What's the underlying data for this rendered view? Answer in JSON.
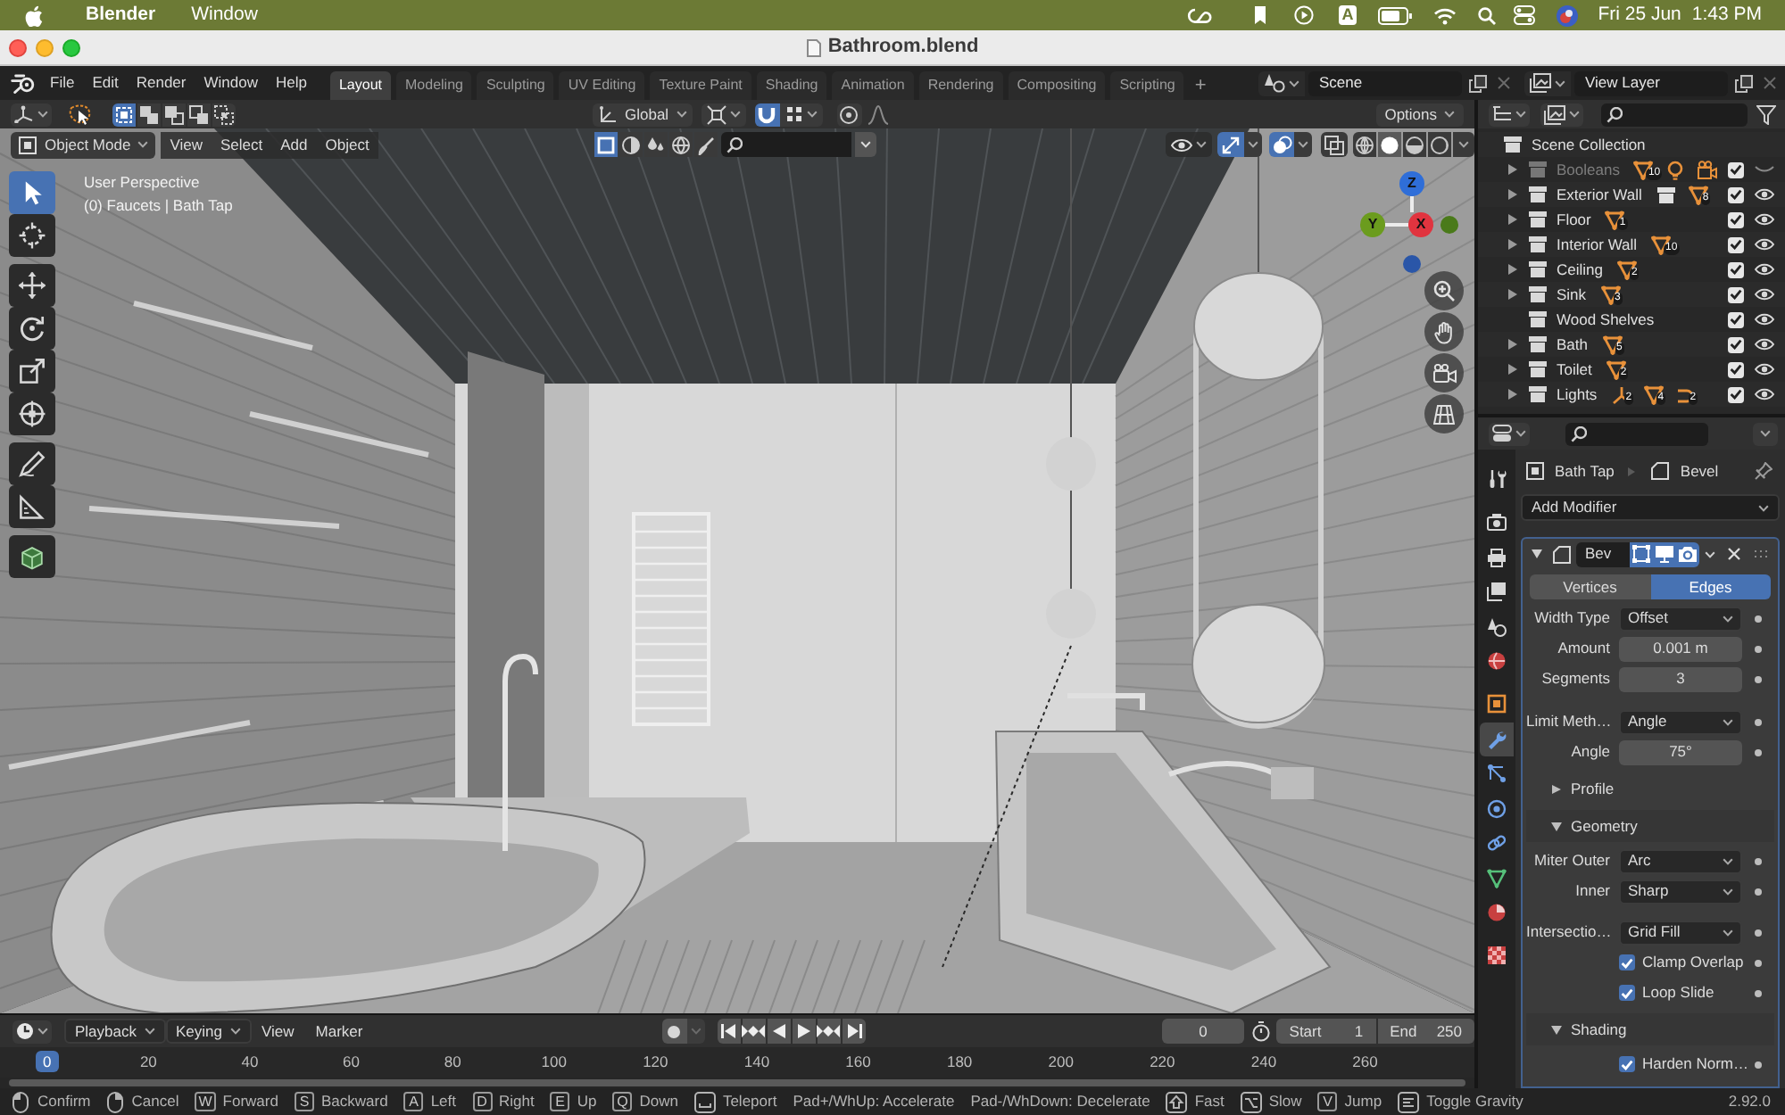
{
  "menu_bar": {
    "app": "Blender",
    "menus": [
      "Window"
    ],
    "input_source": "A",
    "date": "Fri 25 Jun",
    "time": "1:43 PM"
  },
  "window": {
    "title": "Bathroom.blend"
  },
  "top_bar": {
    "menus": [
      "File",
      "Edit",
      "Render",
      "Window",
      "Help"
    ],
    "workspaces": [
      {
        "label": "Layout",
        "selected": true
      },
      {
        "label": "Modeling",
        "selected": false
      },
      {
        "label": "Sculpting",
        "selected": false
      },
      {
        "label": "UV Editing",
        "selected": false
      },
      {
        "label": "Texture Paint",
        "selected": false
      },
      {
        "label": "Shading",
        "selected": false
      },
      {
        "label": "Animation",
        "selected": false
      },
      {
        "label": "Rendering",
        "selected": false
      },
      {
        "label": "Compositing",
        "selected": false
      },
      {
        "label": "Scripting",
        "selected": false
      }
    ],
    "add_workspace": "+",
    "scene": "Scene",
    "view_layer": "View Layer"
  },
  "viewport": {
    "tool_settings": {
      "select_modes": [
        {
          "selected": true
        },
        {
          "selected": false
        },
        {
          "selected": false
        },
        {
          "selected": false
        },
        {
          "selected": false
        }
      ],
      "orientation": "Global",
      "snap": true,
      "proportional": false,
      "options": "Options"
    },
    "header": {
      "mode": "Object Mode",
      "menus": [
        "View",
        "Select",
        "Add",
        "Object"
      ],
      "filters": [
        {
          "selected": true
        },
        {
          "selected": false
        },
        {
          "selected": false
        },
        {
          "selected": false
        },
        {
          "selected": false
        }
      ],
      "gizmos": true,
      "overlays": true,
      "xray": false,
      "shading": [
        {
          "selected": false
        },
        {
          "selected": true
        },
        {
          "selected": false
        },
        {
          "selected": false
        }
      ]
    },
    "info": [
      "User Perspective",
      "(0) Faucets | Bath Tap"
    ],
    "tools": [
      {
        "selected": true
      },
      {
        "selected": false
      },
      {
        "selected": false
      },
      {
        "selected": false
      },
      {
        "selected": false
      },
      {
        "selected": false
      },
      {
        "selected": false
      },
      {
        "selected": false
      },
      {
        "selected": false
      }
    ],
    "axes": [
      {
        "label": "Z",
        "color": "#2f6ed8"
      },
      {
        "label": "Y",
        "color": "#6b9c1e"
      },
      {
        "label": "X",
        "color": "#e0343f"
      }
    ]
  },
  "outliner": {
    "root": "Scene Collection",
    "collections": [
      {
        "name": "Booleans",
        "expandable": true,
        "included": true,
        "visible": false,
        "badges": [
          {
            "kind": "mesh",
            "count": "10"
          },
          {
            "kind": "light"
          },
          {
            "kind": "camera"
          }
        ]
      },
      {
        "name": "Exterior Wall",
        "expandable": true,
        "included": true,
        "visible": true,
        "badges": [
          {
            "kind": "collection"
          },
          {
            "kind": "mesh",
            "count": "8"
          }
        ]
      },
      {
        "name": "Floor",
        "expandable": true,
        "included": true,
        "visible": true,
        "badges": [
          {
            "kind": "mesh",
            "count": "1"
          }
        ]
      },
      {
        "name": "Interior Wall",
        "expandable": true,
        "included": true,
        "visible": true,
        "badges": [
          {
            "kind": "mesh",
            "count": "10"
          }
        ]
      },
      {
        "name": "Ceiling",
        "expandable": true,
        "included": true,
        "visible": true,
        "badges": [
          {
            "kind": "mesh",
            "count": "2"
          }
        ]
      },
      {
        "name": "Sink",
        "expandable": true,
        "included": true,
        "visible": true,
        "badges": [
          {
            "kind": "mesh",
            "count": "3"
          }
        ]
      },
      {
        "name": "Wood Shelves",
        "expandable": false,
        "included": true,
        "visible": true
      },
      {
        "name": "Bath",
        "expandable": true,
        "included": true,
        "visible": true,
        "badges": [
          {
            "kind": "mesh",
            "count": "5"
          }
        ]
      },
      {
        "name": "Toilet",
        "expandable": true,
        "included": true,
        "visible": true,
        "badges": [
          {
            "kind": "mesh",
            "count": "2"
          }
        ]
      },
      {
        "name": "Lights",
        "expandable": true,
        "included": true,
        "visible": true,
        "badges": [
          {
            "kind": "empty",
            "count": "2"
          },
          {
            "kind": "mesh",
            "count": "4"
          },
          {
            "kind": "curve",
            "count": "2"
          }
        ]
      }
    ]
  },
  "properties": {
    "tabs": [
      {
        "selected": false
      },
      {
        "selected": false
      },
      {
        "selected": false
      },
      {
        "selected": false
      },
      {
        "selected": false
      },
      {
        "selected": false
      },
      {
        "selected": false
      },
      {
        "selected": true
      },
      {
        "selected": false
      },
      {
        "selected": false
      },
      {
        "selected": false
      },
      {
        "selected": false
      },
      {
        "selected": false
      },
      {
        "selected": false
      }
    ],
    "object": "Bath Tap",
    "modifier_crumb": "Bevel",
    "add_modifier": "Add Modifier",
    "modifier": {
      "name": "Bev",
      "expanded": true,
      "toggles": [
        {
          "on": true
        },
        {
          "on": true
        },
        {
          "on": true
        }
      ],
      "affect": [
        {
          "label": "Vertices",
          "selected": false
        },
        {
          "label": "Edges",
          "selected": true
        }
      ],
      "rows": [
        {
          "kind": "dropdown",
          "label": "Width Type",
          "value": "Offset"
        },
        {
          "kind": "number",
          "label": "Amount",
          "value": "0.001 m"
        },
        {
          "kind": "number",
          "label": "Segments",
          "value": "3"
        },
        {
          "kind": "dropdown",
          "label": "Limit Meth…",
          "value": "Angle"
        },
        {
          "kind": "number",
          "label": "Angle",
          "value": "75°"
        },
        {
          "kind": "subpanel",
          "label": "Profile",
          "expanded": false
        },
        {
          "kind": "subpanel",
          "label": "Geometry",
          "expanded": true,
          "children": [
            {
              "kind": "dropdown",
              "label": "Miter Outer",
              "value": "Arc"
            },
            {
              "kind": "dropdown",
              "label": "Inner",
              "value": "Sharp"
            },
            {
              "kind": "dropdown",
              "label": "Intersectio…",
              "value": "Grid Fill"
            },
            {
              "kind": "checkbox",
              "label": "Clamp Overlap",
              "checked": true
            },
            {
              "kind": "checkbox",
              "label": "Loop Slide",
              "checked": true
            }
          ]
        },
        {
          "kind": "subpanel",
          "label": "Shading",
          "expanded": true,
          "children": [
            {
              "kind": "checkbox",
              "label": "Harden Norm…",
              "checked": true
            }
          ]
        }
      ]
    }
  },
  "timeline": {
    "menus": [
      {
        "label": "Playback",
        "kind": "dropdown"
      },
      {
        "label": "Keying",
        "kind": "dropdown"
      },
      {
        "label": "View",
        "kind": "menu"
      },
      {
        "label": "Marker",
        "kind": "menu"
      }
    ],
    "current_frame": "0",
    "start_label": "Start",
    "start": "1",
    "end_label": "End",
    "end": "250",
    "playhead": "0",
    "ruler": [
      "20",
      "40",
      "60",
      "80",
      "100",
      "120",
      "140",
      "160",
      "180",
      "200",
      "220",
      "240",
      "260"
    ]
  },
  "status_bar": {
    "hints": [
      {
        "kind": "mouse-left",
        "label": "Confirm"
      },
      {
        "kind": "mouse-right",
        "label": "Cancel"
      },
      {
        "kind": "key",
        "key": "W",
        "label": "Forward"
      },
      {
        "kind": "key",
        "key": "S",
        "label": "Backward"
      },
      {
        "kind": "key",
        "key": "A",
        "label": "Left"
      },
      {
        "kind": "key",
        "key": "D",
        "label": "Right"
      },
      {
        "kind": "key",
        "key": "E",
        "label": "Up"
      },
      {
        "kind": "key",
        "key": "Q",
        "label": "Down"
      },
      {
        "kind": "space",
        "label": "Teleport"
      },
      {
        "kind": "text",
        "label": "Pad+/WhUp: Accelerate"
      },
      {
        "kind": "text",
        "label": "Pad-/WhDown: Decelerate"
      },
      {
        "kind": "shift",
        "label": "Fast"
      },
      {
        "kind": "alt",
        "label": "Slow"
      },
      {
        "kind": "key",
        "key": "V",
        "label": "Jump"
      },
      {
        "kind": "tab",
        "label": "Toggle Gravity"
      }
    ],
    "version": "2.92.0"
  }
}
